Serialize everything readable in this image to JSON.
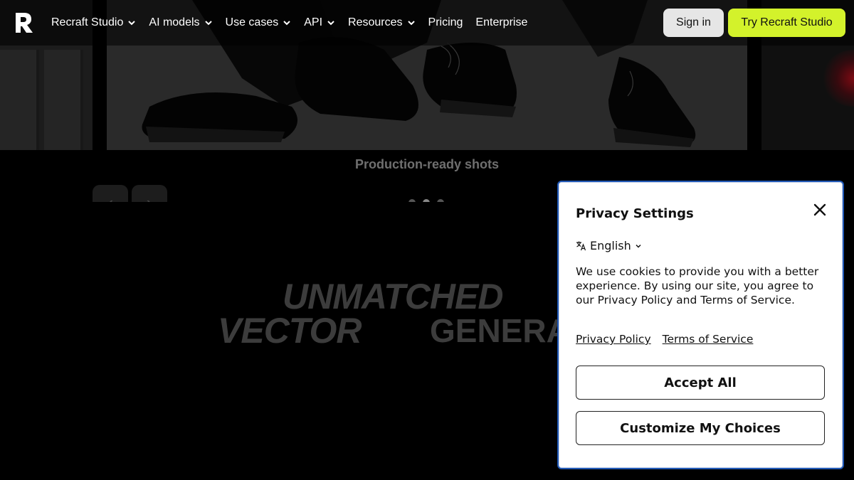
{
  "header": {
    "logo_icon": "recraft-logo-icon",
    "nav": [
      {
        "label": "Recraft Studio",
        "has_dropdown": true
      },
      {
        "label": "AI models",
        "has_dropdown": true
      },
      {
        "label": "Use cases",
        "has_dropdown": true
      },
      {
        "label": "API",
        "has_dropdown": true
      },
      {
        "label": "Resources",
        "has_dropdown": true
      },
      {
        "label": "Pricing",
        "has_dropdown": false
      },
      {
        "label": "Enterprise",
        "has_dropdown": false
      }
    ],
    "sign_in_label": "Sign in",
    "try_label": "Try Recraft Studio",
    "try_color": "#d3f22b"
  },
  "carousel": {
    "caption": "Production-ready shots",
    "prev_icon": "chevron-left-icon",
    "next_icon": "chevron-right-icon",
    "dot_count": 3,
    "active_dot": 1
  },
  "headline": {
    "line1": "UNMATCHED",
    "line2_italic": "VECTOR",
    "line2_plain": "GENERA"
  },
  "privacy": {
    "title": "Privacy Settings",
    "language": "English",
    "body": "We use cookies to provide you with a better experience. By using our site, you agree to our Privacy Policy and Terms of Service.",
    "link_privacy": "Privacy Policy",
    "link_terms": "Terms of Service",
    "accept_label": "Accept All",
    "customize_label": "Customize My Choices",
    "border_color": "#1f57b5"
  }
}
